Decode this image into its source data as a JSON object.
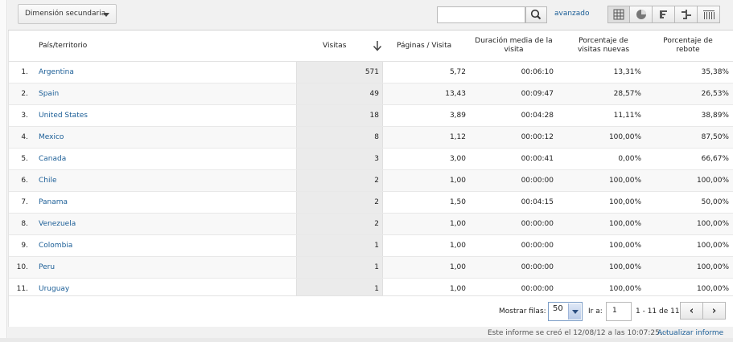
{
  "toolbar": {
    "secondary_dimension": "Dimensión secundaria",
    "search_value": "",
    "advanced_label": "avanzado",
    "view_icons": [
      "table-view-icon",
      "pie-view-icon",
      "performance-view-icon",
      "comparison-view-icon",
      "pivot-view-icon"
    ]
  },
  "table": {
    "headers": {
      "country": "País/territorio",
      "visits": "Visitas",
      "pages": "Páginas / Visita",
      "duration": "Duración media de la visita",
      "new_visits": "Porcentaje de visitas nuevas",
      "bounce": "Porcentaje de rebote"
    },
    "sort_icon": "sort-down-arrow-icon",
    "rows": [
      {
        "idx": "1.",
        "country": "Argentina",
        "visits": "571",
        "pages": "5,72",
        "duration": "00:06:10",
        "new_visits": "13,31%",
        "bounce": "35,38%"
      },
      {
        "idx": "2.",
        "country": "Spain",
        "visits": "49",
        "pages": "13,43",
        "duration": "00:09:47",
        "new_visits": "28,57%",
        "bounce": "26,53%"
      },
      {
        "idx": "3.",
        "country": "United States",
        "visits": "18",
        "pages": "3,89",
        "duration": "00:04:28",
        "new_visits": "11,11%",
        "bounce": "38,89%"
      },
      {
        "idx": "4.",
        "country": "Mexico",
        "visits": "8",
        "pages": "1,12",
        "duration": "00:00:12",
        "new_visits": "100,00%",
        "bounce": "87,50%"
      },
      {
        "idx": "5.",
        "country": "Canada",
        "visits": "3",
        "pages": "3,00",
        "duration": "00:00:41",
        "new_visits": "0,00%",
        "bounce": "66,67%"
      },
      {
        "idx": "6.",
        "country": "Chile",
        "visits": "2",
        "pages": "1,00",
        "duration": "00:00:00",
        "new_visits": "100,00%",
        "bounce": "100,00%"
      },
      {
        "idx": "7.",
        "country": "Panama",
        "visits": "2",
        "pages": "1,50",
        "duration": "00:04:15",
        "new_visits": "100,00%",
        "bounce": "50,00%"
      },
      {
        "idx": "8.",
        "country": "Venezuela",
        "visits": "2",
        "pages": "1,00",
        "duration": "00:00:00",
        "new_visits": "100,00%",
        "bounce": "100,00%"
      },
      {
        "idx": "9.",
        "country": "Colombia",
        "visits": "1",
        "pages": "1,00",
        "duration": "00:00:00",
        "new_visits": "100,00%",
        "bounce": "100,00%"
      },
      {
        "idx": "10.",
        "country": "Peru",
        "visits": "1",
        "pages": "1,00",
        "duration": "00:00:00",
        "new_visits": "100,00%",
        "bounce": "100,00%"
      },
      {
        "idx": "11.",
        "country": "Uruguay",
        "visits": "1",
        "pages": "1,00",
        "duration": "00:00:00",
        "new_visits": "100,00%",
        "bounce": "100,00%"
      }
    ]
  },
  "footer": {
    "show_rows_label": "Mostrar filas:",
    "rows_selected": "50",
    "goto_label": "Ir a:",
    "goto_value": "1",
    "range": "1 - 11 de 11",
    "prev_icon": "chevron-left-icon",
    "next_icon": "chevron-right-icon",
    "created_text": "Este informe se creó el 12/08/12 a las 10:07:25. -",
    "update_label": "Actualizar informe"
  },
  "colors": {
    "link": "#1a5d96",
    "sorted_column_bg": "#ebebeb"
  }
}
